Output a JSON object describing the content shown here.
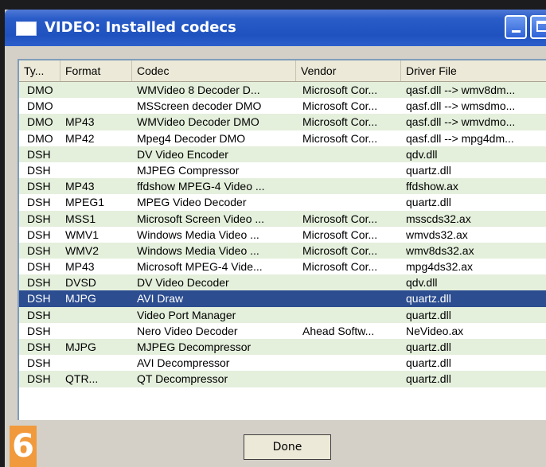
{
  "window": {
    "title": "VIDEO: Installed codecs"
  },
  "columns": [
    "Ty...",
    "Format",
    "Codec",
    "Vendor",
    "Driver File"
  ],
  "rows": [
    {
      "type": "DMO",
      "format": "",
      "codec": "WMVideo 8 Decoder D...",
      "vendor": "Microsoft Cor...",
      "driver": "qasf.dll --> wmv8dm..."
    },
    {
      "type": "DMO",
      "format": "",
      "codec": "MSScreen decoder DMO",
      "vendor": "Microsoft Cor...",
      "driver": "qasf.dll --> wmsdmo..."
    },
    {
      "type": "DMO",
      "format": "MP43",
      "codec": "WMVideo Decoder DMO",
      "vendor": "Microsoft Cor...",
      "driver": "qasf.dll --> wmvdmo..."
    },
    {
      "type": "DMO",
      "format": "MP42",
      "codec": "Mpeg4 Decoder DMO",
      "vendor": "Microsoft Cor...",
      "driver": "qasf.dll --> mpg4dm..."
    },
    {
      "type": "DSH",
      "format": "",
      "codec": "DV Video Encoder",
      "vendor": "",
      "driver": "qdv.dll"
    },
    {
      "type": "DSH",
      "format": "",
      "codec": "MJPEG Compressor",
      "vendor": "",
      "driver": "quartz.dll"
    },
    {
      "type": "DSH",
      "format": "MP43",
      "codec": "ffdshow MPEG-4 Video ...",
      "vendor": "",
      "driver": "ffdshow.ax"
    },
    {
      "type": "DSH",
      "format": "MPEG1",
      "codec": "MPEG Video Decoder",
      "vendor": "",
      "driver": "quartz.dll"
    },
    {
      "type": "DSH",
      "format": "MSS1",
      "codec": "Microsoft Screen Video ...",
      "vendor": "Microsoft Cor...",
      "driver": "msscds32.ax"
    },
    {
      "type": "DSH",
      "format": "WMV1",
      "codec": "Windows Media Video ...",
      "vendor": "Microsoft Cor...",
      "driver": "wmvds32.ax"
    },
    {
      "type": "DSH",
      "format": "WMV2",
      "codec": "Windows Media Video ...",
      "vendor": "Microsoft Cor...",
      "driver": "wmv8ds32.ax"
    },
    {
      "type": "DSH",
      "format": "MP43",
      "codec": "Microsoft MPEG-4 Vide...",
      "vendor": "Microsoft Cor...",
      "driver": "mpg4ds32.ax"
    },
    {
      "type": "DSH",
      "format": "DVSD",
      "codec": "DV Video Decoder",
      "vendor": "",
      "driver": "qdv.dll"
    },
    {
      "type": "DSH",
      "format": "MJPG",
      "codec": "AVI Draw",
      "vendor": "",
      "driver": "quartz.dll"
    },
    {
      "type": "DSH",
      "format": "",
      "codec": "Video Port Manager",
      "vendor": "",
      "driver": "quartz.dll"
    },
    {
      "type": "DSH",
      "format": "",
      "codec": "Nero Video Decoder",
      "vendor": "Ahead Softw...",
      "driver": "NeVideo.ax"
    },
    {
      "type": "DSH",
      "format": "MJPG",
      "codec": "MJPEG Decompressor",
      "vendor": "",
      "driver": "quartz.dll"
    },
    {
      "type": "DSH",
      "format": "",
      "codec": "AVI Decompressor",
      "vendor": "",
      "driver": "quartz.dll"
    },
    {
      "type": "DSH",
      "format": "QTR...",
      "codec": "QT Decompressor",
      "vendor": "",
      "driver": "quartz.dll"
    }
  ],
  "selected_index": 13,
  "footer": {
    "done_label": "Done",
    "step_number": "6"
  },
  "colors": {
    "title_blue": "#2a5cc8",
    "row_alt": "#e4efdc",
    "selection": "#2c4d8f",
    "badge": "#f19a3d"
  }
}
